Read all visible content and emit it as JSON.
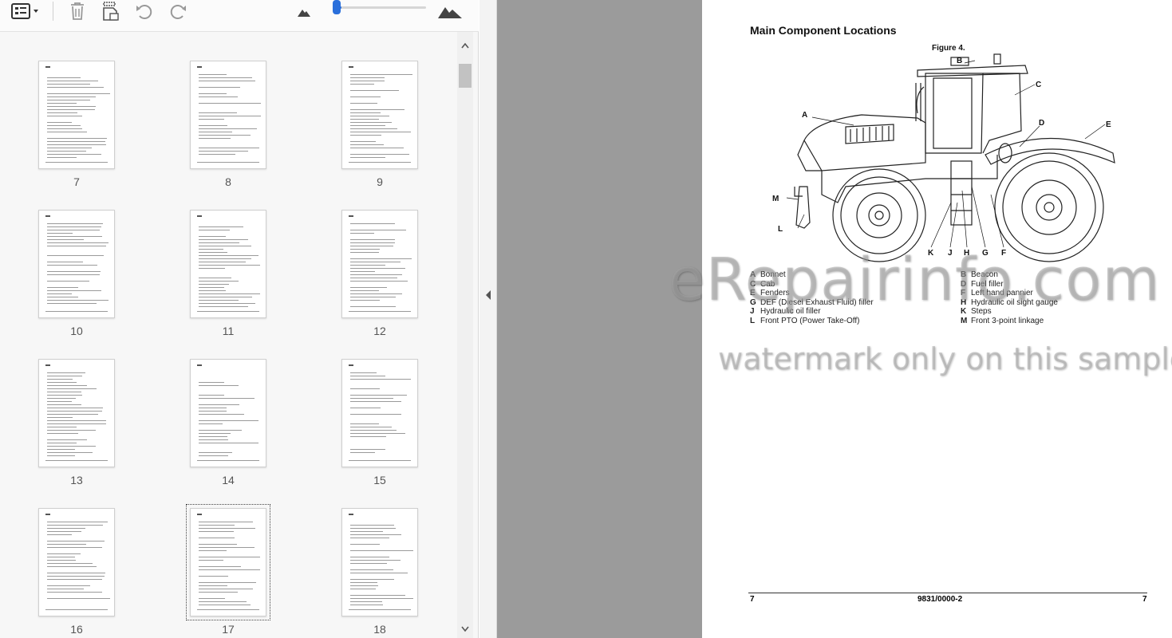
{
  "toolbar": {
    "icons": [
      "page-view-menu-icon",
      "delete-icon",
      "page-properties-icon",
      "rotate-left-icon",
      "rotate-right-icon",
      "zoom-out-small-mountain-icon",
      "zoom-in-large-mountain-icon"
    ],
    "zoom_slider_fraction": 0.05,
    "accent_color": "#2a6fdb"
  },
  "thumbnails": {
    "pages": [
      {
        "number": "7"
      },
      {
        "number": "8"
      },
      {
        "number": "9"
      },
      {
        "number": "10"
      },
      {
        "number": "11"
      },
      {
        "number": "12"
      },
      {
        "number": "13"
      },
      {
        "number": "14"
      },
      {
        "number": "15"
      },
      {
        "number": "16"
      },
      {
        "number": "17"
      },
      {
        "number": "18"
      }
    ],
    "selected_page": "17"
  },
  "document": {
    "title": "Main Component Locations",
    "figure_caption": "Figure 4.",
    "callouts": [
      "A",
      "B",
      "C",
      "D",
      "E",
      "K",
      "J",
      "H",
      "G",
      "F",
      "M",
      "L"
    ],
    "legend": [
      {
        "letter": "A",
        "text": "Bonnet"
      },
      {
        "letter": "B",
        "text": "Beacon"
      },
      {
        "letter": "C",
        "text": "Cab"
      },
      {
        "letter": "D",
        "text": "Fuel filler"
      },
      {
        "letter": "E",
        "text": "Fenders"
      },
      {
        "letter": "F",
        "text": "Left hand pannier"
      },
      {
        "letter": "G",
        "text": "DEF (Diesel Exhaust Fluid) filler"
      },
      {
        "letter": "H",
        "text": "Hydraulic oil sight gauge"
      },
      {
        "letter": "J",
        "text": "Hydraulic oil filler"
      },
      {
        "letter": "K",
        "text": "Steps"
      },
      {
        "letter": "L",
        "text": "Front PTO (Power Take-Off)"
      },
      {
        "letter": "M",
        "text": "Front 3-point linkage"
      }
    ],
    "footer": {
      "left": "7",
      "center": "9831/0000-2",
      "right": "7"
    }
  },
  "watermark": {
    "line1": "eRepairinfo.com",
    "line2": "watermark only on this sample"
  }
}
